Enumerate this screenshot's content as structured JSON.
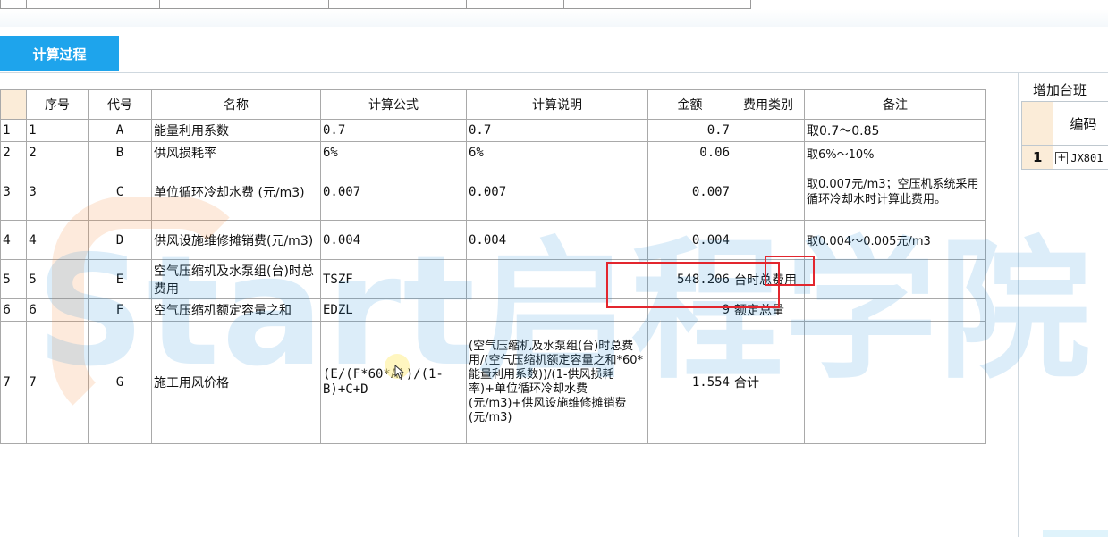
{
  "tab": {
    "active_label": "计算过程"
  },
  "table": {
    "headers": [
      "序号",
      "代号",
      "名称",
      "计算公式",
      "计算说明",
      "金额",
      "费用类别",
      "备注"
    ],
    "rows": [
      {
        "row": "1",
        "seq": "1",
        "code": "A",
        "name": "能量利用系数",
        "formula": "0.7",
        "desc": "0.7",
        "amount": "0.7",
        "category": "",
        "note": "取0.7～0.85"
      },
      {
        "row": "2",
        "seq": "2",
        "code": "B",
        "name": "供风损耗率",
        "formula": "6%",
        "desc": "6%",
        "amount": "0.06",
        "category": "",
        "note": "取6%～10%"
      },
      {
        "row": "3",
        "seq": "3",
        "code": "C",
        "name": "单位循环冷却水费 (元/m3)",
        "formula": "0.007",
        "desc": "0.007",
        "amount": "0.007",
        "category": "",
        "note": "取0.007元/m3；空压机系统采用循环冷却水时计算此费用。"
      },
      {
        "row": "4",
        "seq": "4",
        "code": "D",
        "name": "供风设施维修摊销费(元/m3)",
        "formula": "0.004",
        "desc": "0.004",
        "amount": "0.004",
        "category": "",
        "note": "取0.004～0.005元/m3"
      },
      {
        "row": "5",
        "seq": "5",
        "code": "E",
        "name": "空气压缩机及水泵组(台)时总费用",
        "formula": "TSZF",
        "desc": "",
        "amount": "548.206",
        "category": "台时总费用",
        "note": ""
      },
      {
        "row": "6",
        "seq": "6",
        "code": "F",
        "name": "空气压缩机额定容量之和",
        "formula": "EDZL",
        "desc": "",
        "amount": "9",
        "category": "额定总量",
        "note": ""
      },
      {
        "row": "7",
        "seq": "7",
        "code": "G",
        "name": "施工用风价格",
        "formula": "(E/(F*60*A))/(1-B)+C+D",
        "desc": "(空气压缩机及水泵组(台)时总费用/(空气压缩机额定容量之和*60*能量利用系数))/(1-供风损耗率)+单位循环冷却水费 (元/m3)+供风设施维修摊销费(元/m3)",
        "amount": "1.554",
        "category": "合计",
        "note": ""
      }
    ]
  },
  "watermark": {
    "text": "Start启程学院"
  },
  "right_panel": {
    "title": "增加台班",
    "column_header": "编码",
    "rows": [
      {
        "num": "1",
        "code": "JX801"
      }
    ]
  },
  "colors": {
    "accent": "#1ea4ec",
    "corner": "#fbecd8",
    "highlight": "#e3262e"
  },
  "icons": {
    "expand": "plus-box-icon",
    "cursor": "mouse-cursor-icon"
  }
}
